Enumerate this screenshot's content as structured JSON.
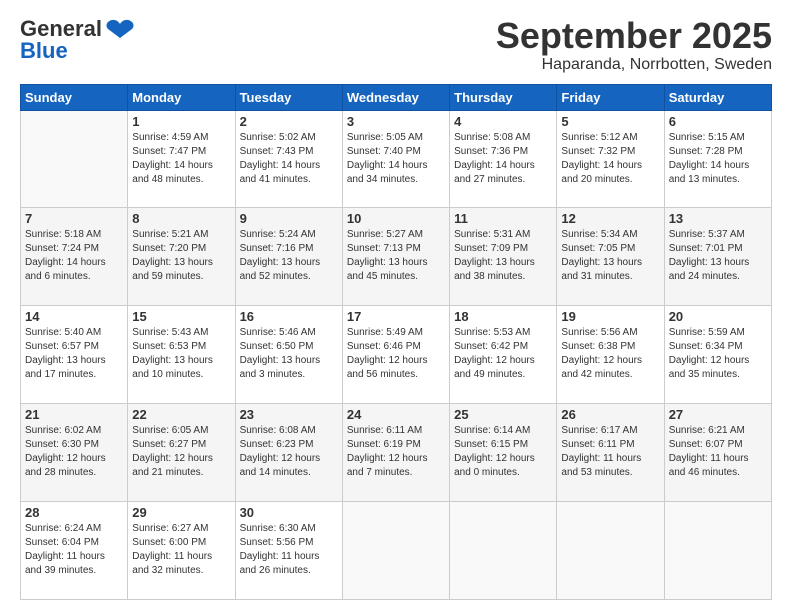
{
  "logo": {
    "name_part1": "General",
    "name_part2": "Blue"
  },
  "header": {
    "month": "September 2025",
    "location": "Haparanda, Norrbotten, Sweden"
  },
  "days_of_week": [
    "Sunday",
    "Monday",
    "Tuesday",
    "Wednesday",
    "Thursday",
    "Friday",
    "Saturday"
  ],
  "weeks": [
    [
      {
        "day": "",
        "info": ""
      },
      {
        "day": "1",
        "info": "Sunrise: 4:59 AM\nSunset: 7:47 PM\nDaylight: 14 hours\nand 48 minutes."
      },
      {
        "day": "2",
        "info": "Sunrise: 5:02 AM\nSunset: 7:43 PM\nDaylight: 14 hours\nand 41 minutes."
      },
      {
        "day": "3",
        "info": "Sunrise: 5:05 AM\nSunset: 7:40 PM\nDaylight: 14 hours\nand 34 minutes."
      },
      {
        "day": "4",
        "info": "Sunrise: 5:08 AM\nSunset: 7:36 PM\nDaylight: 14 hours\nand 27 minutes."
      },
      {
        "day": "5",
        "info": "Sunrise: 5:12 AM\nSunset: 7:32 PM\nDaylight: 14 hours\nand 20 minutes."
      },
      {
        "day": "6",
        "info": "Sunrise: 5:15 AM\nSunset: 7:28 PM\nDaylight: 14 hours\nand 13 minutes."
      }
    ],
    [
      {
        "day": "7",
        "info": "Sunrise: 5:18 AM\nSunset: 7:24 PM\nDaylight: 14 hours\nand 6 minutes."
      },
      {
        "day": "8",
        "info": "Sunrise: 5:21 AM\nSunset: 7:20 PM\nDaylight: 13 hours\nand 59 minutes."
      },
      {
        "day": "9",
        "info": "Sunrise: 5:24 AM\nSunset: 7:16 PM\nDaylight: 13 hours\nand 52 minutes."
      },
      {
        "day": "10",
        "info": "Sunrise: 5:27 AM\nSunset: 7:13 PM\nDaylight: 13 hours\nand 45 minutes."
      },
      {
        "day": "11",
        "info": "Sunrise: 5:31 AM\nSunset: 7:09 PM\nDaylight: 13 hours\nand 38 minutes."
      },
      {
        "day": "12",
        "info": "Sunrise: 5:34 AM\nSunset: 7:05 PM\nDaylight: 13 hours\nand 31 minutes."
      },
      {
        "day": "13",
        "info": "Sunrise: 5:37 AM\nSunset: 7:01 PM\nDaylight: 13 hours\nand 24 minutes."
      }
    ],
    [
      {
        "day": "14",
        "info": "Sunrise: 5:40 AM\nSunset: 6:57 PM\nDaylight: 13 hours\nand 17 minutes."
      },
      {
        "day": "15",
        "info": "Sunrise: 5:43 AM\nSunset: 6:53 PM\nDaylight: 13 hours\nand 10 minutes."
      },
      {
        "day": "16",
        "info": "Sunrise: 5:46 AM\nSunset: 6:50 PM\nDaylight: 13 hours\nand 3 minutes."
      },
      {
        "day": "17",
        "info": "Sunrise: 5:49 AM\nSunset: 6:46 PM\nDaylight: 12 hours\nand 56 minutes."
      },
      {
        "day": "18",
        "info": "Sunrise: 5:53 AM\nSunset: 6:42 PM\nDaylight: 12 hours\nand 49 minutes."
      },
      {
        "day": "19",
        "info": "Sunrise: 5:56 AM\nSunset: 6:38 PM\nDaylight: 12 hours\nand 42 minutes."
      },
      {
        "day": "20",
        "info": "Sunrise: 5:59 AM\nSunset: 6:34 PM\nDaylight: 12 hours\nand 35 minutes."
      }
    ],
    [
      {
        "day": "21",
        "info": "Sunrise: 6:02 AM\nSunset: 6:30 PM\nDaylight: 12 hours\nand 28 minutes."
      },
      {
        "day": "22",
        "info": "Sunrise: 6:05 AM\nSunset: 6:27 PM\nDaylight: 12 hours\nand 21 minutes."
      },
      {
        "day": "23",
        "info": "Sunrise: 6:08 AM\nSunset: 6:23 PM\nDaylight: 12 hours\nand 14 minutes."
      },
      {
        "day": "24",
        "info": "Sunrise: 6:11 AM\nSunset: 6:19 PM\nDaylight: 12 hours\nand 7 minutes."
      },
      {
        "day": "25",
        "info": "Sunrise: 6:14 AM\nSunset: 6:15 PM\nDaylight: 12 hours\nand 0 minutes."
      },
      {
        "day": "26",
        "info": "Sunrise: 6:17 AM\nSunset: 6:11 PM\nDaylight: 11 hours\nand 53 minutes."
      },
      {
        "day": "27",
        "info": "Sunrise: 6:21 AM\nSunset: 6:07 PM\nDaylight: 11 hours\nand 46 minutes."
      }
    ],
    [
      {
        "day": "28",
        "info": "Sunrise: 6:24 AM\nSunset: 6:04 PM\nDaylight: 11 hours\nand 39 minutes."
      },
      {
        "day": "29",
        "info": "Sunrise: 6:27 AM\nSunset: 6:00 PM\nDaylight: 11 hours\nand 32 minutes."
      },
      {
        "day": "30",
        "info": "Sunrise: 6:30 AM\nSunset: 5:56 PM\nDaylight: 11 hours\nand 26 minutes."
      },
      {
        "day": "",
        "info": ""
      },
      {
        "day": "",
        "info": ""
      },
      {
        "day": "",
        "info": ""
      },
      {
        "day": "",
        "info": ""
      }
    ]
  ]
}
